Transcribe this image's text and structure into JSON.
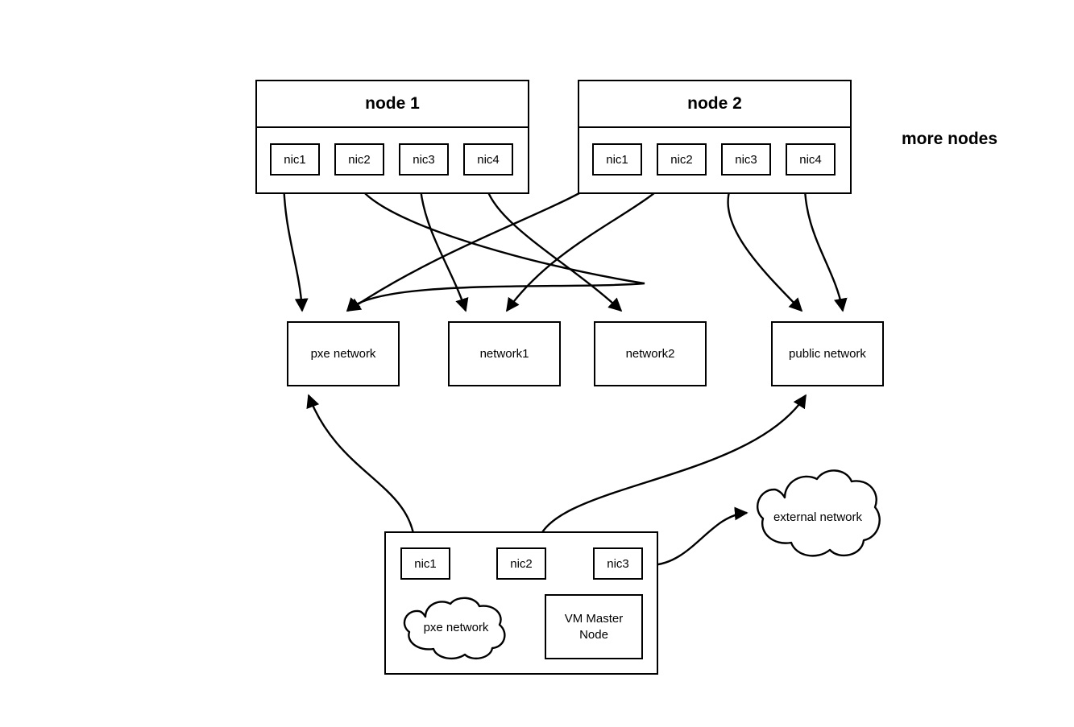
{
  "diagram": {
    "title_text": "more nodes",
    "stroke_color": "#000000",
    "background_color": "#ffffff"
  },
  "nodes": [
    {
      "title": "node 1",
      "nics": [
        "nic1",
        "nic2",
        "nic3",
        "nic4"
      ]
    },
    {
      "title": "node 2",
      "nics": [
        "nic1",
        "nic2",
        "nic3",
        "nic4"
      ]
    }
  ],
  "more_nodes_label": "more nodes",
  "networks": [
    {
      "label": "pxe network"
    },
    {
      "label": "network1"
    },
    {
      "label": "network2"
    },
    {
      "label": "public network"
    }
  ],
  "vm_box": {
    "nics": [
      "nic1",
      "nic2",
      "nic3"
    ],
    "cloud_label": "pxe network",
    "master_label": "VM Master\nNode",
    "master_label_line1": "VM Master",
    "master_label_line2": "Node"
  },
  "external": {
    "cloud_label": "external network"
  },
  "connections": [
    {
      "from": "node1.nic1",
      "to": "pxe network"
    },
    {
      "from": "node1.nic2",
      "to": "network1"
    },
    {
      "from": "node1.nic3",
      "to": "network2"
    },
    {
      "from": "node1.nic4",
      "to": "public network"
    },
    {
      "from": "node2.nic1",
      "to": "pxe network"
    },
    {
      "from": "node2.nic2",
      "to": "network1"
    },
    {
      "from": "node2.nic3",
      "to": "network2"
    },
    {
      "from": "node2.nic4",
      "to": "public network"
    },
    {
      "from": "vm.nic1",
      "to": "pxe network"
    },
    {
      "from": "vm.nic2",
      "to": "public network"
    },
    {
      "from": "vm.nic3",
      "to": "external network"
    },
    {
      "from": "VM Master Node",
      "to": "vm.pxe network"
    },
    {
      "from": "vm.nic1",
      "to": "vm.pxe network"
    }
  ]
}
